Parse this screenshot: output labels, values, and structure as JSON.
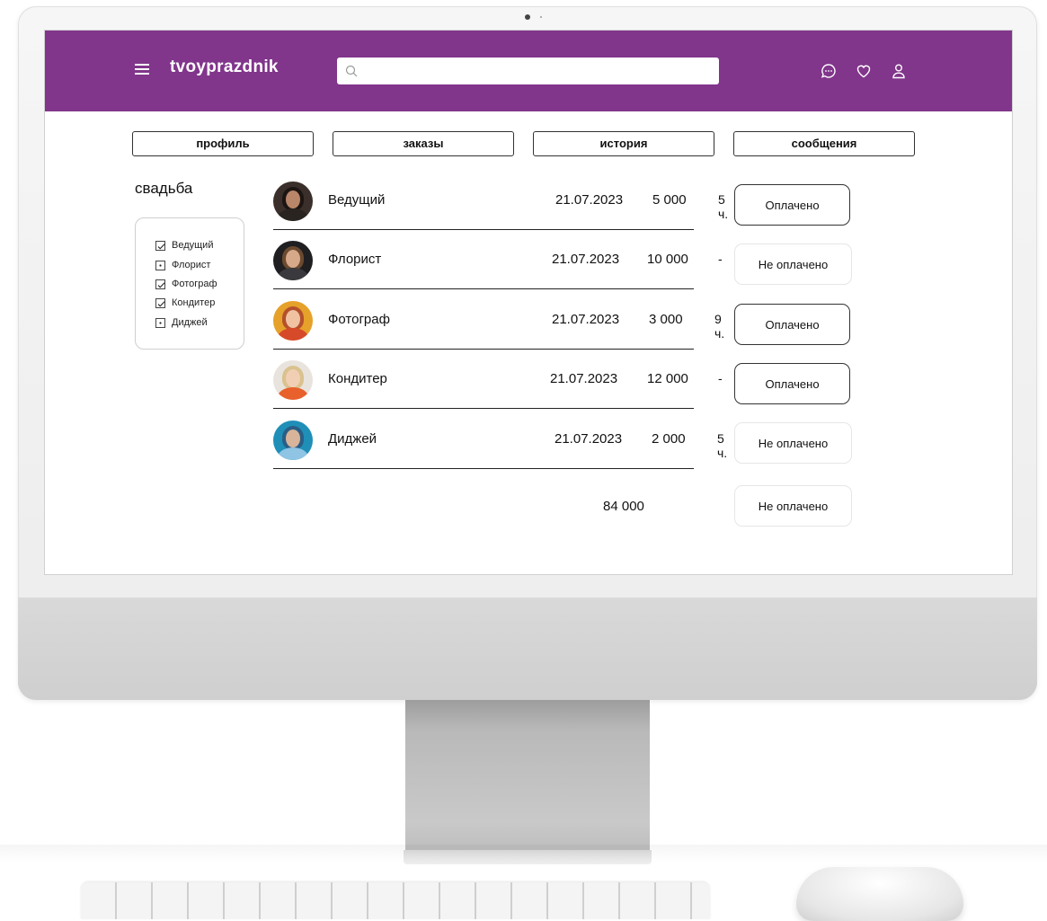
{
  "header": {
    "logo": "tvoyprazdnik",
    "search_placeholder": ""
  },
  "tabs": [
    {
      "label": "профиль"
    },
    {
      "label": "заказы"
    },
    {
      "label": "история"
    },
    {
      "label": "сообщения"
    }
  ],
  "event": {
    "title": "свадьба"
  },
  "filters": [
    {
      "label": "Ведущий",
      "checked": true
    },
    {
      "label": "Флорист",
      "checked": false
    },
    {
      "label": "Фотограф",
      "checked": true
    },
    {
      "label": "Кондитер",
      "checked": true
    },
    {
      "label": "Диджей",
      "checked": false
    }
  ],
  "orders": [
    {
      "name": "Ведущий",
      "date": "21.07.2023",
      "price": "5 000",
      "duration": "5 ч.",
      "status": "Оплачено",
      "paid": true
    },
    {
      "name": "Флорист",
      "date": "21.07.2023",
      "price": "10 000",
      "duration": "-",
      "status": "Не оплачено",
      "paid": false
    },
    {
      "name": "Фотограф",
      "date": "21.07.2023",
      "price": "3 000",
      "duration": "9 ч.",
      "status": "Оплачено",
      "paid": true
    },
    {
      "name": "Кондитер",
      "date": "21.07.2023",
      "price": "12 000",
      "duration": "-",
      "status": "Оплачено",
      "paid": true
    },
    {
      "name": "Диджей",
      "date": "21.07.2023",
      "price": "2 000",
      "duration": "5 ч.",
      "status": "Не оплачено",
      "paid": false
    }
  ],
  "summary": {
    "total": "84 000",
    "status": "Не оплачено"
  },
  "colors": {
    "header_bg": "#81358b"
  }
}
